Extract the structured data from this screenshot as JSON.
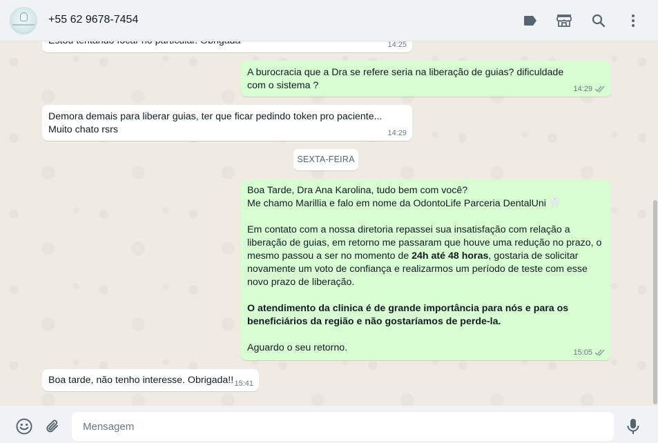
{
  "header": {
    "contact_name": "+55 62 9678-7454",
    "icons": [
      "label-icon",
      "catalog-store-icon",
      "search-icon",
      "menu-dots-icon"
    ]
  },
  "messages": [
    {
      "direction": "in",
      "text": "Estou tentando focar no particular. Obrigada",
      "time": "14:25"
    },
    {
      "direction": "out",
      "text": "A burocracia que a Dra se refere seria na liberação de guias? dificuldade com o sistema ?",
      "time": "14:29",
      "status": "read"
    },
    {
      "direction": "in",
      "text_line1": "Demora demais para liberar guias, ter que ficar pedindo token pro paciente...",
      "text_line2": "Muito chato rsrs",
      "time": "14:29"
    },
    {
      "type": "date",
      "label": "SEXTA-FEIRA"
    },
    {
      "direction": "out",
      "greeting_line1": "Boa Tarde, Dra Ana Karolina, tudo bem com você?",
      "greeting_line2": "Me chamo Marillia e falo em nome da OdontoLife Parceria DentalUni",
      "greeting_emoji": "🦷",
      "para1_before": "Em contato com a nossa diretoria repassei sua insatisfação com relação a liberação de guias, em retorno me passaram que houve uma redução no prazo, o mesmo passou a ser no momento de ",
      "para1_bold": "24h até 48 horas",
      "para1_after": ", gostaria de solicitar novamente um voto de confiança e realizarmos um período de teste com esse novo prazo de liberação.",
      "para2_bold": "O atendimento da clinica é de grande importância para nós e para os beneficiários da região e não gostaríamos de perde-la.",
      "closing": "Aguardo o seu retorno.",
      "time": "15:05",
      "status": "read"
    },
    {
      "direction": "in",
      "text": "Boa tarde, não tenho interesse. Obrigada!!",
      "time": "15:41"
    }
  ],
  "footer": {
    "placeholder": "Mensagem",
    "icons": [
      "emoji-icon",
      "attach-icon",
      "microphone-icon"
    ]
  },
  "colors": {
    "incoming_bubble": "#ffffff",
    "outgoing_bubble": "#d9fdd3",
    "chat_background": "#efeae2",
    "header_background": "#f0f2f5",
    "read_ticks": "#8696a0"
  }
}
